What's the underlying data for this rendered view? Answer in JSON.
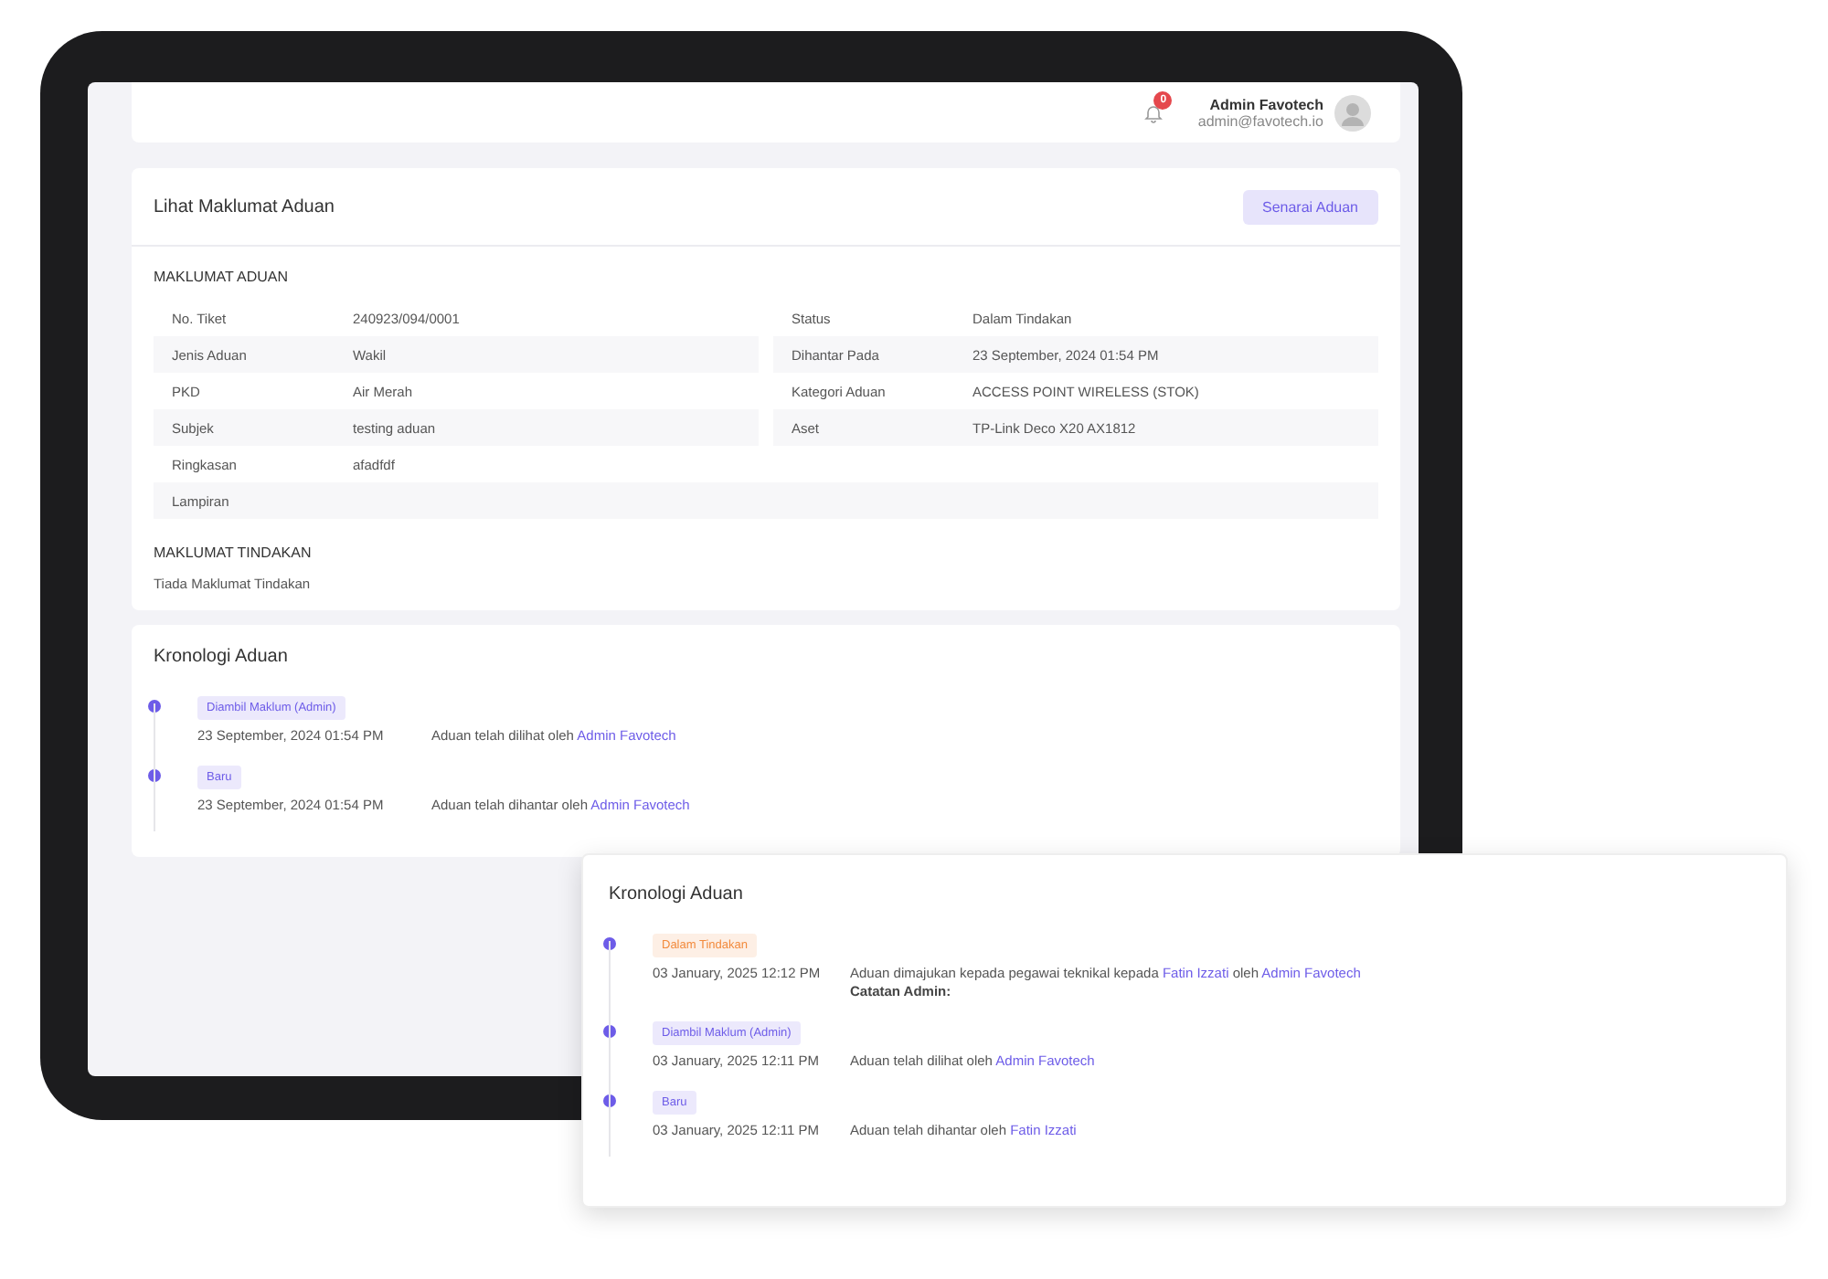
{
  "header": {
    "notification_count": "0",
    "user_name": "Admin Favotech",
    "user_email": "admin@favotech.io"
  },
  "detail": {
    "title": "Lihat Maklumat Aduan",
    "button": "Senarai Aduan",
    "section_title": "MAKLUMAT ADUAN",
    "rows": [
      {
        "cells": [
          {
            "label": "No. Tiket",
            "value": "240923/094/0001"
          },
          {
            "label": "Status",
            "value": "Dalam Tindakan"
          }
        ]
      },
      {
        "cells": [
          {
            "label": "Jenis Aduan",
            "value": "Wakil"
          },
          {
            "label": "Dihantar Pada",
            "value": "23 September, 2024 01:54 PM"
          }
        ]
      },
      {
        "cells": [
          {
            "label": "PKD",
            "value": "Air Merah"
          },
          {
            "label": "Kategori Aduan",
            "value": "ACCESS POINT WIRELESS (STOK)"
          }
        ]
      },
      {
        "cells": [
          {
            "label": "Subjek",
            "value": "testing aduan"
          },
          {
            "label": "Aset",
            "value": "TP-Link Deco X20 AX1812"
          }
        ]
      },
      {
        "cells": [
          {
            "label": "Ringkasan",
            "value": "afadfdf"
          }
        ]
      },
      {
        "cells": [
          {
            "label": "Lampiran"
          }
        ]
      }
    ],
    "action_title": "MAKLUMAT TINDAKAN",
    "action_text": "Tiada Maklumat Tindakan"
  },
  "timelines": [
    {
      "title": "Kronologi Aduan",
      "events": [
        {
          "badge": "Diambil Maklum (Admin)",
          "color": "#6d5ce8",
          "date": "23 September, 2024 01:54 PM",
          "message": [
            {
              "kind": "text",
              "text": "Aduan telah dilihat oleh "
            },
            {
              "kind": "link",
              "text": "Admin Favotech"
            }
          ]
        },
        {
          "badge": "Baru",
          "color": "#6d5ce8",
          "date": "23 September, 2024 01:54 PM",
          "message": [
            {
              "kind": "text",
              "text": "Aduan telah dihantar oleh "
            },
            {
              "kind": "link",
              "text": "Admin Favotech"
            }
          ]
        }
      ]
    },
    {
      "title": "Kronologi Aduan",
      "events": [
        {
          "badge": "Dalam Tindakan",
          "color": "#f28a3c",
          "date": "03 January, 2025 12:12 PM",
          "message": [
            {
              "kind": "text",
              "text": "Aduan dimajukan kepada pegawai teknikal kepada "
            },
            {
              "kind": "link",
              "text": "Fatin Izzati"
            },
            {
              "kind": "text",
              "text": " oleh "
            },
            {
              "kind": "link",
              "text": "Admin Favotech"
            }
          ],
          "note": "Catatan Admin:"
        },
        {
          "badge": "Diambil Maklum (Admin)",
          "color": "#6d5ce8",
          "date": "03 January, 2025 12:11 PM",
          "message": [
            {
              "kind": "text",
              "text": "Aduan telah dilihat oleh "
            },
            {
              "kind": "link",
              "text": "Admin Favotech"
            }
          ]
        },
        {
          "badge": "Baru",
          "color": "#6d5ce8",
          "date": "03 January, 2025 12:11 PM",
          "message": [
            {
              "kind": "text",
              "text": "Aduan telah dihantar oleh "
            },
            {
              "kind": "link",
              "text": "Fatin Izzati"
            }
          ]
        }
      ]
    }
  ]
}
